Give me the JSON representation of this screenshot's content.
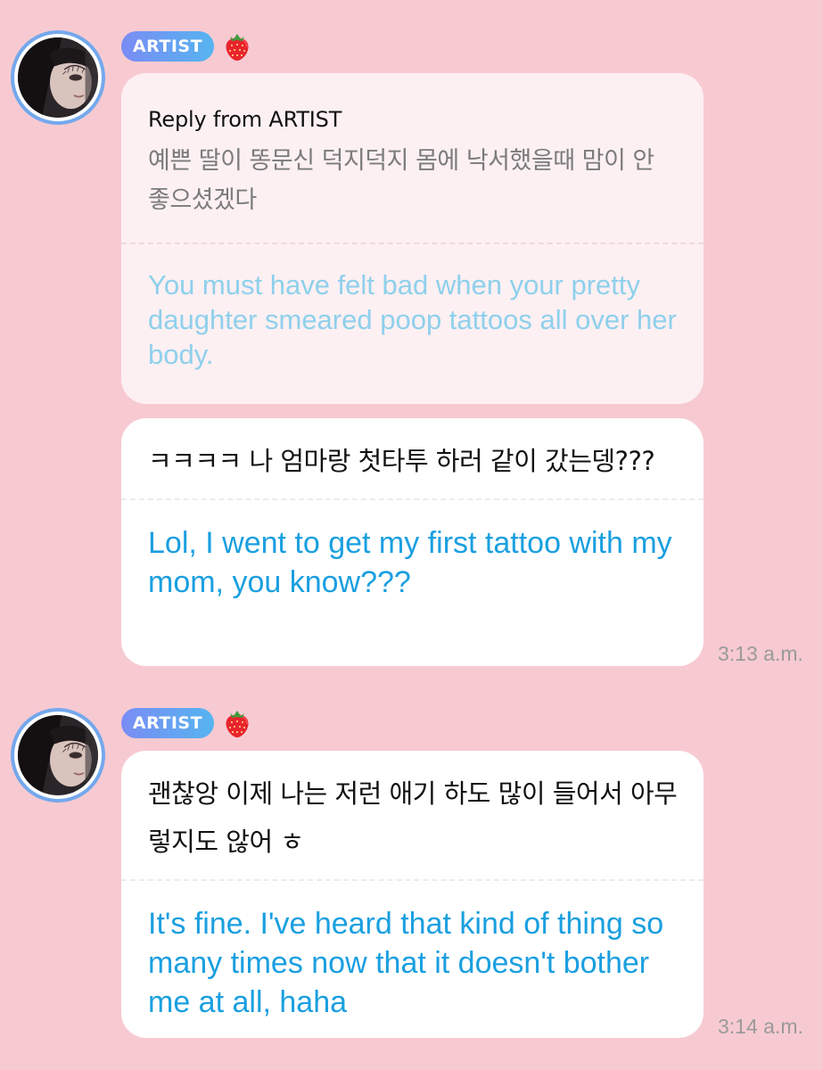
{
  "colors": {
    "background": "#f7cad2",
    "avatar_ring": "#74a8ec",
    "badge_gradient_start": "#7a8cf4",
    "badge_gradient_end": "#56b4f0",
    "reply_bubble": "#fdf0f2",
    "message_bubble": "#ffffff",
    "translation_text": "#1a9fe0",
    "reply_translation_text": "#8ed0ec",
    "timestamp_text": "#9a9a9a"
  },
  "messages": [
    {
      "sender_badge": "ARTIST",
      "sender_icon": "strawberry-icon",
      "avatar": "artist-avatar",
      "reply": {
        "title": "Reply from ARTIST",
        "korean": "예쁜 딸이 똥문신 덕지덕지 몸에 낙서했을때 맘이 안 좋으셨겠다",
        "english": "You must have felt bad when your pretty daughter smeared poop tattoos all over her body."
      },
      "korean": "ㅋㅋㅋㅋ 나 엄마랑 첫타투 하러 같이 갔는뎅???",
      "english": "Lol, I went to get my first tattoo with my mom, you know???",
      "time": "3:13 a.m."
    },
    {
      "sender_badge": "ARTIST",
      "sender_icon": "strawberry-icon",
      "avatar": "artist-avatar",
      "korean": "괜찮앙 이제 나는 저런 애기 하도 많이 들어서 아무렇지도 않어 ㅎ",
      "english": "It's fine. I've heard that kind of thing so many times now that it doesn't bother me at all, haha",
      "time": "3:14 a.m."
    }
  ]
}
